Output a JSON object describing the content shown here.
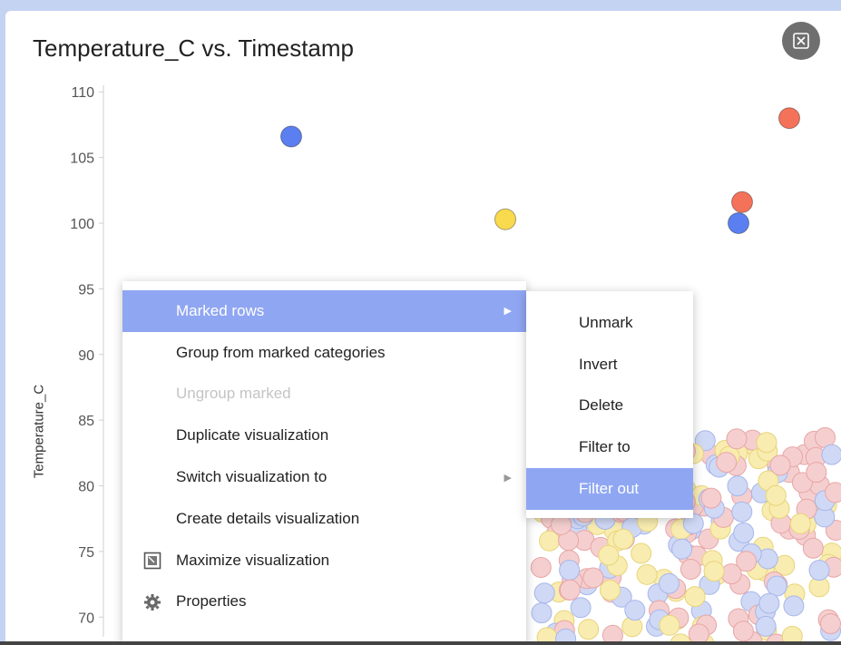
{
  "chart_data": {
    "type": "scatter",
    "title": "Temperature_C vs. Timestamp",
    "ylabel": "Temperature_C",
    "xlabel": "",
    "ylim": [
      68.5,
      110.5
    ],
    "yticks": [
      110,
      105,
      100,
      95,
      90,
      85,
      80,
      75,
      70
    ],
    "series": [
      {
        "color": "#5b7ff0",
        "values": [
          106.6,
          100.0
        ]
      },
      {
        "color": "#f9d94e",
        "values": [
          100.3
        ]
      },
      {
        "color": "#f4715a",
        "values": [
          108.0,
          101.6
        ]
      }
    ]
  },
  "menu": {
    "items": [
      {
        "label": "Marked rows",
        "has_submenu": true,
        "active": true
      },
      {
        "label": "Group from marked categories"
      },
      {
        "label": "Ungroup marked",
        "disabled": true
      },
      {
        "label": "Duplicate visualization"
      },
      {
        "label": "Switch visualization to",
        "has_submenu": true
      },
      {
        "label": "Create details visualization"
      },
      {
        "label": "Maximize visualization",
        "icon": "maximize-icon"
      },
      {
        "label": "Properties",
        "icon": "gear-icon"
      }
    ]
  },
  "submenu": {
    "items": [
      {
        "label": "Unmark"
      },
      {
        "label": "Invert"
      },
      {
        "label": "Delete"
      },
      {
        "label": "Filter to"
      },
      {
        "label": "Filter out",
        "active": true
      }
    ]
  },
  "close_icon": "close-visualization-icon"
}
